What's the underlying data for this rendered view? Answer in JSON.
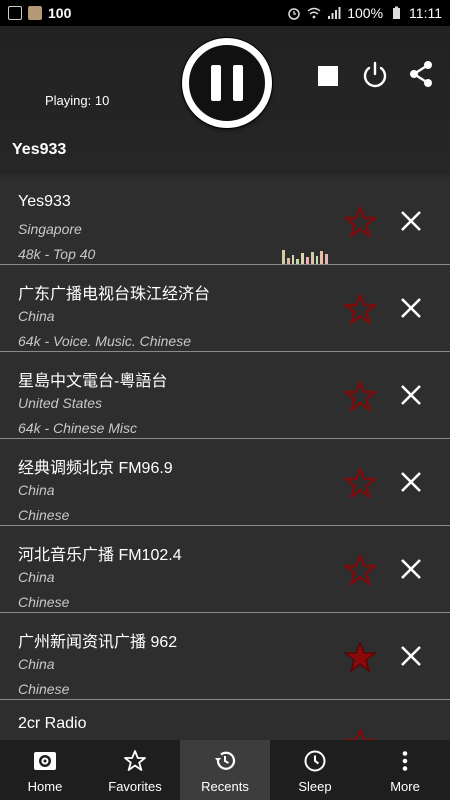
{
  "status_bar": {
    "left_text": "100",
    "battery": "100%",
    "time": "11:11"
  },
  "player": {
    "playing_label": "Playing: 10",
    "current_station": "Yes933"
  },
  "stations": [
    {
      "name": "Yes933",
      "country": "Singapore",
      "info": "48k - Top 40",
      "favorite": false,
      "playing": true
    },
    {
      "name": "广东广播电视台珠江经济台",
      "country": "China",
      "info": "64k - Voice. Music. Chinese",
      "favorite": false
    },
    {
      "name": "星島中文電台-粵語台",
      "country": "United States",
      "info": "64k - Chinese Misc",
      "favorite": false
    },
    {
      "name": "经典调频北京 FM96.9",
      "country": "China",
      "info": "Chinese",
      "favorite": false
    },
    {
      "name": "河北音乐广播 FM102.4",
      "country": "China",
      "info": "Chinese",
      "favorite": false
    },
    {
      "name": "广州新闻资讯广播 962",
      "country": "China",
      "info": "Chinese",
      "favorite": true
    },
    {
      "name": "2cr Radio",
      "country": "",
      "info": "",
      "favorite": false
    }
  ],
  "nav": {
    "home": "Home",
    "favorites": "Favorites",
    "recents": "Recents",
    "sleep": "Sleep",
    "more": "More"
  },
  "colors": {
    "star_outline": "#7a0d0d",
    "star_filled": "#8b0a0a",
    "active_tab": "#3d3d3d"
  }
}
